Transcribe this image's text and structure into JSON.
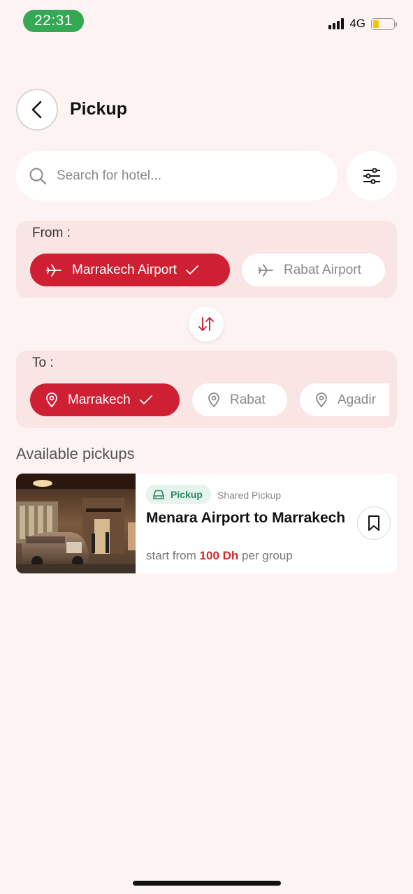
{
  "status_bar": {
    "time": "22:31",
    "network": "4G",
    "battery_level": 0.3
  },
  "header": {
    "title": "Pickup"
  },
  "search": {
    "placeholder": "Search for hotel..."
  },
  "from": {
    "label": "From :",
    "options": [
      {
        "label": "Marrakech Airport",
        "selected": true,
        "icon": "plane-icon"
      },
      {
        "label": "Rabat Airport",
        "selected": false,
        "icon": "plane-icon"
      }
    ]
  },
  "to": {
    "label": "To :",
    "options": [
      {
        "label": "Marrakech",
        "selected": true,
        "icon": "map-pin-icon"
      },
      {
        "label": "Rabat",
        "selected": false,
        "icon": "map-pin-icon"
      },
      {
        "label": "Agadir",
        "selected": false,
        "icon": "map-pin-icon"
      }
    ]
  },
  "pickups": {
    "section_title": "Available pickups",
    "items": [
      {
        "badge": "Pickup",
        "type": "Shared Pickup",
        "title": "Menara Airport to Marrakech",
        "price_prefix": "start from",
        "price": "100 Dh",
        "price_suffix": "per group"
      }
    ]
  },
  "colors": {
    "accent": "#cf1f33",
    "background": "#fdf3f3",
    "panel": "#fae5e5",
    "badge_green": "#2a8a5c",
    "status_green": "#34a853"
  }
}
